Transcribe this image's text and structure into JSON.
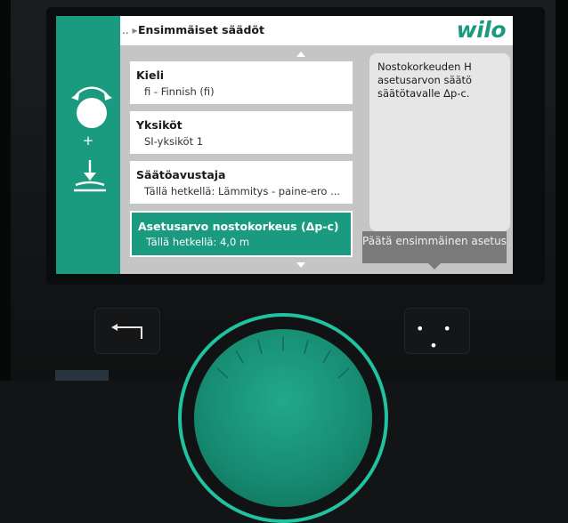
{
  "header": {
    "breadcrumb_glyph": "..",
    "title": "Ensimmäiset säädöt",
    "logo": "wilo"
  },
  "list": {
    "items": [
      {
        "title": "Kieli",
        "value": "fi - Finnish (fi)",
        "selected": false
      },
      {
        "title": "Yksiköt",
        "value": "SI-yksiköt 1",
        "selected": false
      },
      {
        "title": "Säätöavustaja",
        "value": "Tällä hetkellä: Lämmitys - paine-ero ...",
        "selected": false
      },
      {
        "title": "Asetusarvo nostokorkeus (Δp-c)",
        "value": "Tällä hetkellä: 4,0 m",
        "selected": true
      }
    ]
  },
  "info": {
    "text": "Nostokorkeuden H asetusarvon säätö säätötavalle Δp-c."
  },
  "confirm_button": {
    "label": "Päätä ensimmäinen asetus"
  },
  "side_panel": {
    "plus": "+",
    "icons": [
      "rotate-knob-icon",
      "push-knob-icon"
    ]
  },
  "hardware": {
    "back_button_icon": "return-arrow-icon",
    "context_button_label": "• • •"
  },
  "colors": {
    "accent": "#1a9a7e",
    "dial_ring": "#20c2a0",
    "pane_grey": "#c5c5c5",
    "confirm_grey": "#7a7a7a"
  }
}
